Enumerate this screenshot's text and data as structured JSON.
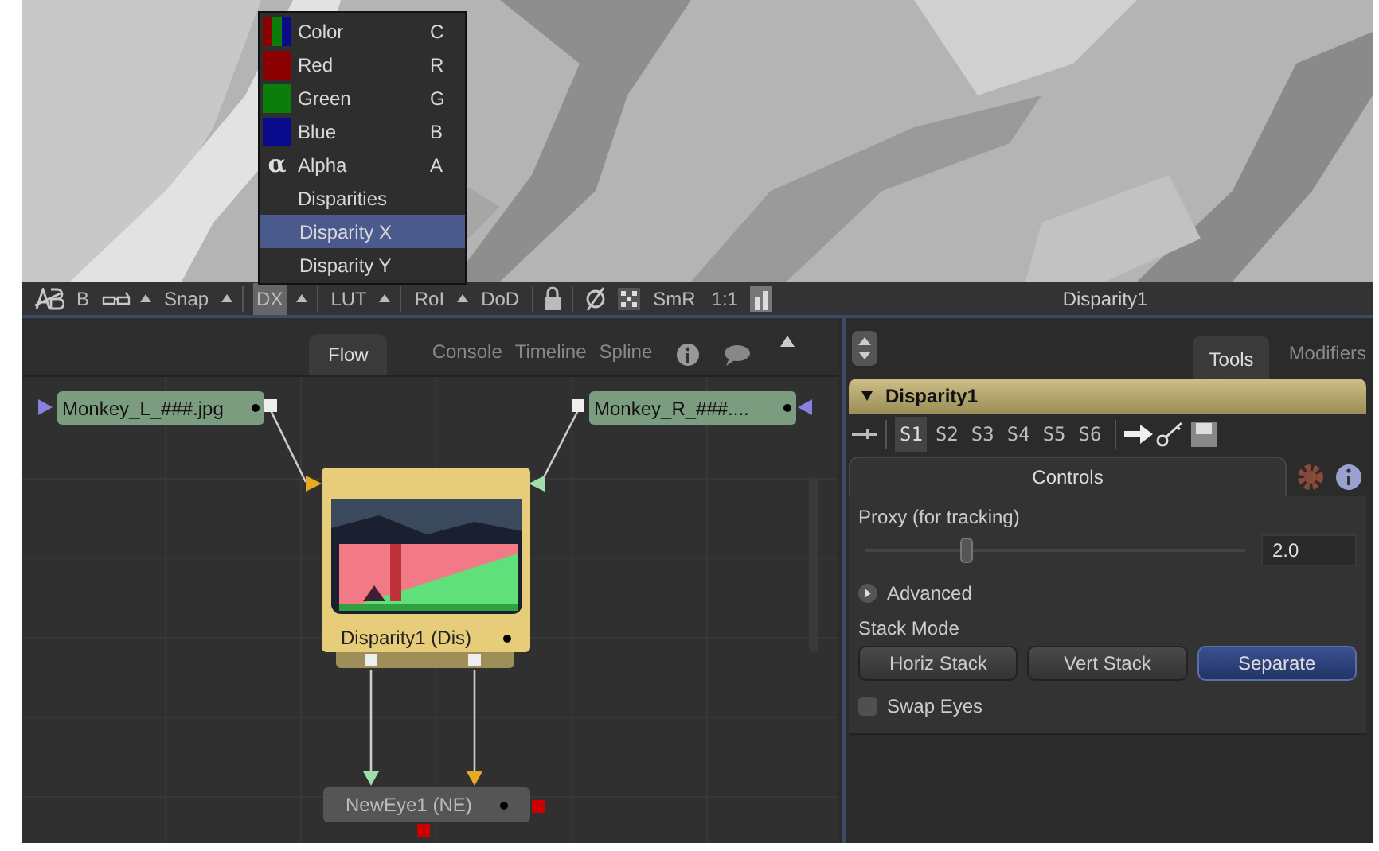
{
  "channel_menu": [
    {
      "kind": "tricolor",
      "label": "Color",
      "shortcut": "C",
      "selected": false
    },
    {
      "kind": "swatch",
      "label": "Red",
      "shortcut": "R",
      "color": "#8b0000",
      "selected": false
    },
    {
      "kind": "swatch",
      "label": "Green",
      "shortcut": "G",
      "color": "#0a7d0a",
      "selected": false
    },
    {
      "kind": "swatch",
      "label": "Blue",
      "shortcut": "B",
      "color": "#0a0a8c",
      "selected": false
    },
    {
      "kind": "glyph",
      "glyph": "α",
      "label": "Alpha",
      "shortcut": "A",
      "selected": false
    },
    {
      "kind": "group",
      "label": "Disparities",
      "selected": false
    },
    {
      "kind": "sub",
      "label": "Disparity X",
      "selected": true
    },
    {
      "kind": "sub",
      "label": "Disparity Y",
      "selected": false
    }
  ],
  "toolbar": [
    {
      "label": "B",
      "selected": false
    },
    {
      "label": "Snap",
      "selected": false
    },
    {
      "label": "DX",
      "selected": true
    },
    {
      "label": "LUT",
      "selected": false
    },
    {
      "label": "RoI",
      "selected": false
    },
    {
      "label": "DoD",
      "selected": false
    },
    {
      "label": "SmR",
      "selected": false
    },
    {
      "label": "1:1",
      "selected": false
    }
  ],
  "viewer_title": "Disparity1",
  "flow_tabs": [
    {
      "label": "Flow",
      "selected": true
    },
    {
      "label": "Console",
      "selected": false
    },
    {
      "label": "Timeline",
      "selected": false
    },
    {
      "label": "Spline",
      "selected": false
    }
  ],
  "nodes": [
    {
      "kind": "loader",
      "label": "Monkey_L_###.jpg"
    },
    {
      "kind": "loader",
      "label": "Monkey_R_###...."
    },
    {
      "kind": "thumbnail",
      "label": "Disparity1  (Dis)"
    },
    {
      "kind": "plain",
      "label": "NewEye1  (NE)"
    }
  ],
  "inspector_tabs": [
    {
      "label": "Tools",
      "selected": true
    },
    {
      "label": "Modifiers",
      "selected": false
    }
  ],
  "tool": {
    "name": "Disparity1",
    "expanded": true,
    "slots": [
      {
        "label": "S1",
        "selected": true
      },
      {
        "label": "S2",
        "selected": false
      },
      {
        "label": "S3",
        "selected": false
      },
      {
        "label": "S4",
        "selected": false
      },
      {
        "label": "S5",
        "selected": false
      },
      {
        "label": "S6",
        "selected": false
      }
    ],
    "controls_tab": "Controls",
    "proxy": {
      "label": "Proxy (for tracking)",
      "level": 0.28,
      "value": "2.0"
    },
    "advanced": {
      "label": "Advanced",
      "expanded": false
    },
    "stack_mode": {
      "label": "Stack Mode",
      "options": [
        {
          "label": "Horiz Stack",
          "selected": false
        },
        {
          "label": "Vert Stack",
          "selected": false
        },
        {
          "label": "Separate",
          "selected": true
        }
      ]
    },
    "swap_eyes": {
      "label": "Swap Eyes",
      "checked": false
    }
  }
}
